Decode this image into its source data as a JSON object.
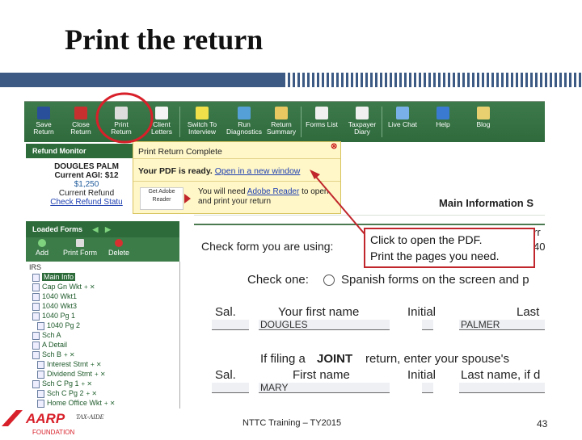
{
  "slide": {
    "title": "Print the return",
    "footer_center": "NTTC Training – TY2015",
    "page_number": "43",
    "logo_text": "AARP",
    "logo_sub": "FOUNDATION",
    "tax_aide": "TAX-AIDE"
  },
  "toolbar": {
    "buttons": [
      {
        "label1": "Save",
        "label2": "Return",
        "icon": "save-icon",
        "color": "#2a4f9a"
      },
      {
        "label1": "Close",
        "label2": "Return",
        "icon": "close-return-icon",
        "color": "#c83030"
      },
      {
        "label1": "Print",
        "label2": "Return",
        "icon": "print-icon",
        "color": "#dddddd"
      },
      {
        "label1": "Client",
        "label2": "Letters",
        "icon": "letters-icon",
        "color": "#f4f4f4"
      },
      {
        "label1": "Switch To",
        "label2": "Interview",
        "icon": "interview-icon",
        "color": "#f2e04a"
      },
      {
        "label1": "Run",
        "label2": "Diagnostics",
        "icon": "diagnostics-icon",
        "color": "#56a0d8"
      },
      {
        "label1": "Return",
        "label2": "Summary",
        "icon": "summary-icon",
        "color": "#e8c860"
      },
      {
        "label1": "Forms List",
        "label2": "",
        "icon": "forms-list-icon",
        "color": "#f0f0f0"
      },
      {
        "label1": "Taxpayer",
        "label2": "Diary",
        "icon": "diary-icon",
        "color": "#f0f0f0"
      },
      {
        "label1": "Live Chat",
        "label2": "",
        "icon": "chat-icon",
        "color": "#7ab0e8"
      },
      {
        "label1": "Help",
        "label2": "",
        "icon": "help-icon",
        "color": "#3a7ad0"
      },
      {
        "label1": "Blog",
        "label2": "",
        "icon": "blog-icon",
        "color": "#e8d070"
      }
    ]
  },
  "refund_monitor": {
    "heading": "Refund Monitor",
    "name": "DOUGLES PALM",
    "agi": "Current AGI: $12",
    "agi_value": "$1,250",
    "refund_label": "Current Refund",
    "check_link": "Check Refund Statu"
  },
  "loaded_forms": {
    "heading": "Loaded Forms",
    "tools": [
      "Add",
      "Print Form",
      "Delete"
    ],
    "root": "IRS",
    "items": [
      {
        "label": "Main Info",
        "selected": true,
        "ctl": ""
      },
      {
        "label": "Cap Gn Wkt",
        "selected": false,
        "ctl": "+ ✕"
      },
      {
        "label": "1040 Wkt1",
        "selected": false,
        "ctl": ""
      },
      {
        "label": "1040 Wkt3",
        "selected": false,
        "ctl": ""
      },
      {
        "label": "1040 Pg 1",
        "selected": false,
        "ctl": ""
      },
      {
        "label": "1040 Pg 2",
        "selected": false,
        "ctl": ""
      },
      {
        "label": "Sch A",
        "selected": false,
        "ctl": ""
      },
      {
        "label": "A Detail",
        "selected": false,
        "ctl": ""
      },
      {
        "label": "Sch B",
        "selected": false,
        "ctl": "+ ✕"
      },
      {
        "label": "Interest Stmt",
        "selected": false,
        "ctl": "+ ✕"
      },
      {
        "label": "Dividend Stmt",
        "selected": false,
        "ctl": "+ ✕"
      },
      {
        "label": "Sch C Pg 1",
        "selected": false,
        "ctl": "+ ✕"
      },
      {
        "label": "Sch C Pg 2",
        "selected": false,
        "ctl": "+ ✕"
      },
      {
        "label": "Home Office Wkt",
        "selected": false,
        "ctl": "+ ✕"
      }
    ]
  },
  "popup": {
    "title": "Print Return Complete",
    "ready": "Your PDF is ready.",
    "open_link": "Open in a new window",
    "reader_label": "Get Adobe Reader",
    "need1": "You will need ",
    "need_link": "Adobe Reader",
    "need2": " to open",
    "need3": "and print your return"
  },
  "main_form": {
    "header": "Main Information S",
    "check_form": "Check form you are using:",
    "check_one": "Check one:",
    "spanish": "Spanish forms on the screen and p",
    "sal": "Sal.",
    "first_name": "Your first name",
    "initial": "Initial",
    "last": "Last",
    "first_value": "DOUGLES",
    "last_value": "PALMER",
    "if_filing": "If filing a",
    "joint": "JOINT",
    "return_spouse": "return, enter your spouse's",
    "sal2": "Sal.",
    "first_name2": "First name",
    "initial2": "Initial",
    "last_name2": "Last name, if d",
    "spouse_first": "MARY",
    "right_edge1": "rr",
    "right_edge2": "40"
  },
  "callout": {
    "line1": "Click to open the PDF.",
    "line2": "Print the pages you need."
  },
  "colors": {
    "toolbar_green": "#2f6a3c",
    "highlight_red": "#c0262c",
    "title_bar_blue": "#3c5a84"
  }
}
